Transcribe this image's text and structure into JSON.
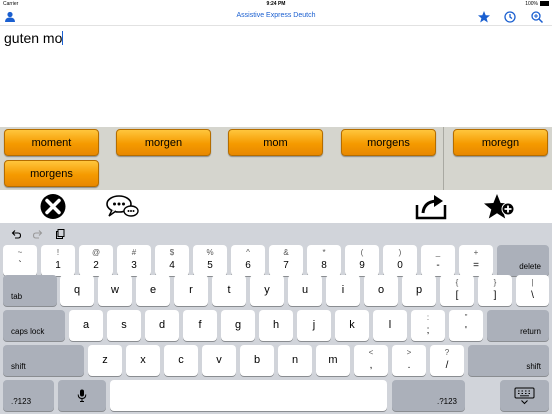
{
  "status_bar": {
    "carrier": "Carrier",
    "time": "9:24 PM",
    "battery": "100%"
  },
  "nav": {
    "title": "Assistive Express Deutch"
  },
  "text": {
    "value": "guten mo"
  },
  "suggestions": [
    "moment",
    "morgen",
    "mom",
    "morgens",
    "moregn",
    "morgens"
  ],
  "keyboard": {
    "row1": [
      {
        "top": "~",
        "bot": "`"
      },
      {
        "top": "!",
        "bot": "1"
      },
      {
        "top": "@",
        "bot": "2"
      },
      {
        "top": "#",
        "bot": "3"
      },
      {
        "top": "$",
        "bot": "4"
      },
      {
        "top": "%",
        "bot": "5"
      },
      {
        "top": "^",
        "bot": "6"
      },
      {
        "top": "&",
        "bot": "7"
      },
      {
        "top": "*",
        "bot": "8"
      },
      {
        "top": "(",
        "bot": "9"
      },
      {
        "top": ")",
        "bot": "0"
      },
      {
        "top": "_",
        "bot": "-"
      },
      {
        "top": "+",
        "bot": "="
      }
    ],
    "delete": "delete",
    "tab": "tab",
    "row2": [
      "q",
      "w",
      "e",
      "r",
      "t",
      "y",
      "u",
      "i",
      "o",
      "p"
    ],
    "row2_sym": [
      {
        "top": "{",
        "bot": "["
      },
      {
        "top": "}",
        "bot": "]"
      },
      {
        "top": "|",
        "bot": "\\"
      }
    ],
    "caps_lock": "caps lock",
    "row3": [
      "a",
      "s",
      "d",
      "f",
      "g",
      "h",
      "j",
      "k",
      "l"
    ],
    "row3_sym": [
      {
        "top": ":",
        "bot": ";"
      },
      {
        "top": "\"",
        "bot": "'"
      }
    ],
    "return": "return",
    "shift": "shift",
    "row4": [
      "z",
      "x",
      "c",
      "v",
      "b",
      "n",
      "m"
    ],
    "row4_sym": [
      {
        "top": "<",
        "bot": ","
      },
      {
        "top": ">",
        "bot": "."
      },
      {
        "top": "?",
        "bot": "/"
      }
    ],
    "numbers": ".?123"
  }
}
